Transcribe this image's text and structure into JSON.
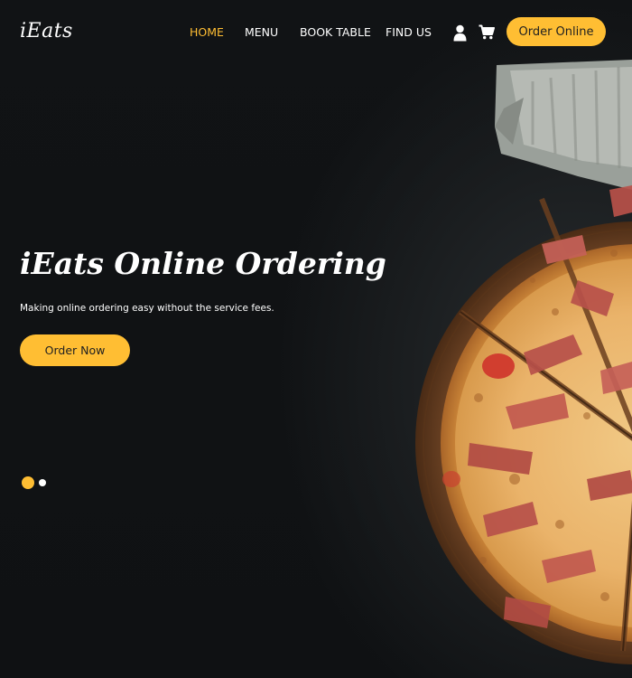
{
  "brand": {
    "logo": "iEats"
  },
  "nav": {
    "items": [
      {
        "label": "HOME",
        "active": true
      },
      {
        "label": "MENU",
        "active": false
      },
      {
        "label": "BOOK TABLE",
        "active": false
      },
      {
        "label": "FIND US",
        "active": false
      }
    ],
    "icons": [
      "user-icon",
      "cart-icon"
    ],
    "cta_label": "Order Online"
  },
  "hero": {
    "title": "iEats Online Ordering",
    "subtitle": "Making online ordering easy without the service fees.",
    "button_label": "Order Now",
    "image": "pizza-on-wooden-board",
    "slides": {
      "count": 2,
      "active": 1
    }
  },
  "colors": {
    "accent": "#ffbe33",
    "background": "#0f1113",
    "text": "#ffffff",
    "button_text": "#212121"
  }
}
